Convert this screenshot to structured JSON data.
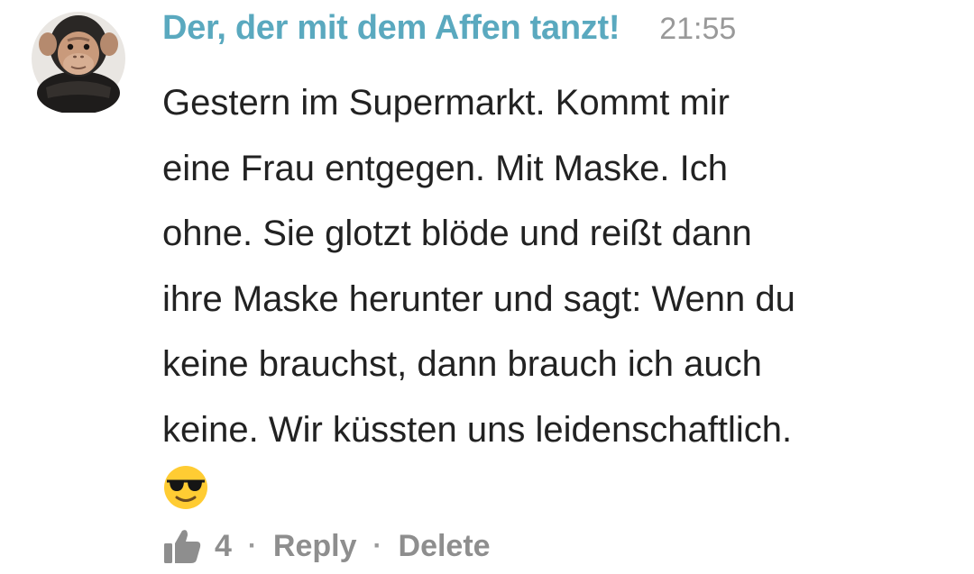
{
  "comment": {
    "author": "Der, der mit dem Affen tanzt!",
    "time": "21:55",
    "lines": [
      "Gestern im Supermarkt. Kommt mir",
      "eine Frau entgegen. Mit Maske. Ich",
      "ohne. Sie glotzt blöde und reißt dann",
      "ihre Maske herunter und sagt: Wenn du",
      "keine brauchst, dann brauch ich auch",
      "keine. Wir küssten uns leidenschaftlich."
    ],
    "emoji_icon": "sunglasses-smiley-icon",
    "avatar_icon": "chimpanzee-avatar"
  },
  "actions": {
    "like_icon": "thumbs-up-icon",
    "like_count": "4",
    "separator": "·",
    "reply_label": "Reply",
    "delete_label": "Delete"
  },
  "colors": {
    "author": "#5aa9bf",
    "time": "#999999",
    "text": "#222222",
    "actions": "#8e8e8e"
  }
}
